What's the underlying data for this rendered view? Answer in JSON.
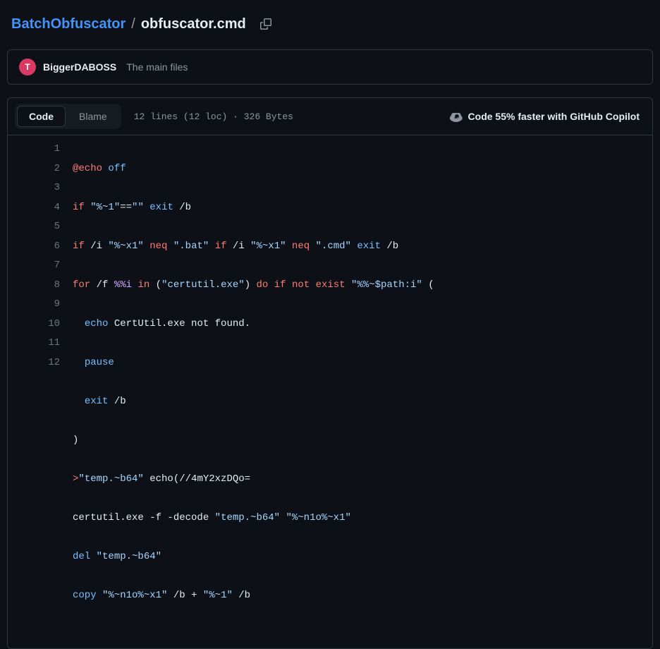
{
  "breadcrumb": {
    "repo": "BatchObfuscator",
    "sep": "/",
    "file": "obfuscator.cmd"
  },
  "commit": {
    "avatar_letter": "T",
    "author": "BiggerDABOSS",
    "message": "The main files"
  },
  "tabs": {
    "code": "Code",
    "blame": "Blame"
  },
  "file_info": "12 lines (12 loc) · 326 Bytes",
  "copilot_label": "Code 55% faster with GitHub Copilot",
  "line_numbers": [
    "1",
    "2",
    "3",
    "4",
    "5",
    "6",
    "7",
    "8",
    "9",
    "10",
    "11",
    "12"
  ],
  "code": {
    "l1": {
      "a": "@echo",
      "b": " off"
    },
    "l2": {
      "a": "if",
      "b": " ",
      "c": "\"%~1\"",
      "d": "==",
      "e": "\"\"",
      "f": " ",
      "g": "exit",
      "h": " /b"
    },
    "l3": {
      "a": "if",
      "b": " /i ",
      "c": "\"%~x1\"",
      "d": " neq ",
      "e": "\".bat\"",
      "f": " ",
      "g": "if",
      "h": " /i ",
      "i": "\"%~x1\"",
      "j": " neq ",
      "k": "\".cmd\"",
      "l": " ",
      "m": "exit",
      "n": " /b"
    },
    "l4": {
      "a": "for",
      "b": " /f ",
      "c": "%%i",
      "d": " ",
      "e": "in",
      "f": " (",
      "g": "\"certutil.exe\"",
      "h": ") ",
      "i": "do",
      "j": " ",
      "k": "if",
      "l": " ",
      "m": "not",
      "n": " ",
      "o": "exist",
      "p": " ",
      "q": "\"%%~$path:i\"",
      "r": " ("
    },
    "l5": {
      "a": "  ",
      "b": "echo",
      "c": " CertUtil.exe not found."
    },
    "l6": {
      "a": "  ",
      "b": "pause"
    },
    "l7": {
      "a": "  ",
      "b": "exit",
      "c": " /b"
    },
    "l8": {
      "a": ")"
    },
    "l9": {
      "a": ">",
      "b": "\"temp.~b64\"",
      "c": " echo(//4mY2xzDQo="
    },
    "l10": {
      "a": "certutil.exe -f -decode ",
      "b": "\"temp.~b64\"",
      "c": " ",
      "d": "\"%~n1o%~x1\""
    },
    "l11": {
      "a": "del",
      "b": " ",
      "c": "\"temp.~b64\""
    },
    "l12": {
      "a": "copy",
      "b": " ",
      "c": "\"%~n1o%~x1\"",
      "d": " /b + ",
      "e": "\"%~1\"",
      "f": " /b"
    }
  }
}
